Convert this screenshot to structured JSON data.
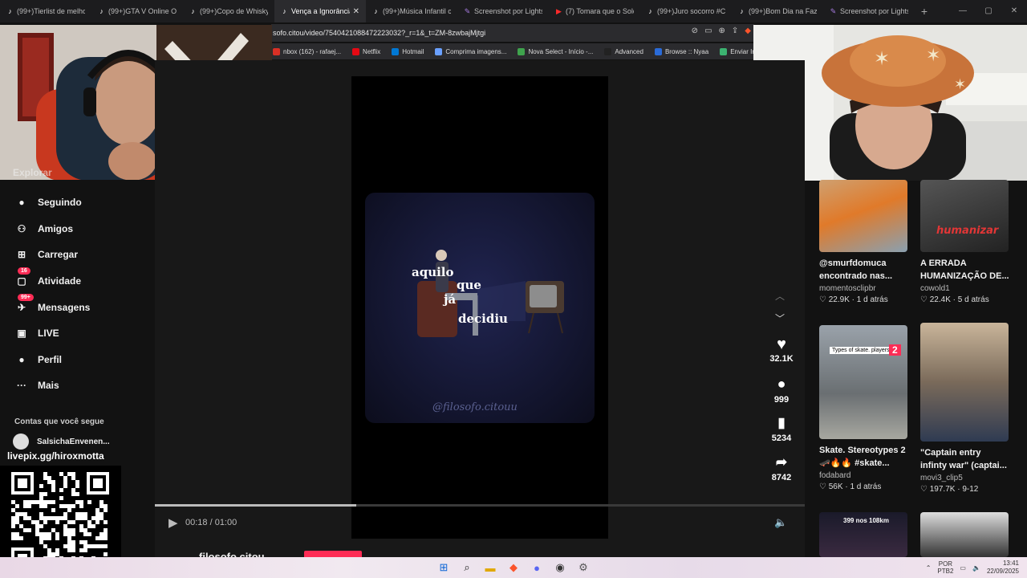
{
  "browser": {
    "tabs": [
      {
        "label": "(99+)Tierlist de melho",
        "icon": "tiktok-icon"
      },
      {
        "label": "(99+)GTA V Online Ou",
        "icon": "tiktok-icon"
      },
      {
        "label": "(99+)Copo de Whisky",
        "icon": "tiktok-icon"
      },
      {
        "label": "Vença a Ignorância",
        "icon": "tiktok-icon",
        "active": true
      },
      {
        "label": "(99+)Música Infantil co",
        "icon": "tiktok-icon"
      },
      {
        "label": "Screenshot por Lightsh",
        "icon": "feather-icon"
      },
      {
        "label": "(7) Tomara que o Sold",
        "icon": "youtube-icon"
      },
      {
        "label": "(99+)Juro socorro #Ca",
        "icon": "tiktok-icon"
      },
      {
        "label": "(99+)Bom Dia na Faze",
        "icon": "tiktok-icon"
      },
      {
        "label": "Screenshot por Lightsh",
        "icon": "feather-icon"
      }
    ],
    "new_tab": "+",
    "url": "sofo.citou/video/7540421088472223032?_r=1&_t=ZM-8zwbajMjtgi",
    "bookmarks": [
      {
        "label": "nbox (162) - rafaej...",
        "color": "#d93025"
      },
      {
        "label": "Netflix",
        "color": "#e50914"
      },
      {
        "label": "Hotmail",
        "color": "#0078d4"
      },
      {
        "label": "Comprima imagens...",
        "color": "#6aa0ff"
      },
      {
        "label": "Nova Select - Início -...",
        "color": "#3fa34d"
      },
      {
        "label": "Advanced",
        "color": "#222222"
      },
      {
        "label": "Browse :: Nyaa",
        "color": "#2a6bd8"
      },
      {
        "label": "Enviar Imagem",
        "color": "#3cb371"
      }
    ]
  },
  "sidebar": {
    "hidden_item": "Explorar",
    "items": [
      {
        "label": "Seguindo",
        "icon": "following-avatar-icon"
      },
      {
        "label": "Amigos",
        "icon": "friends-icon"
      },
      {
        "label": "Carregar",
        "icon": "upload-icon"
      },
      {
        "label": "Atividade",
        "icon": "activity-icon",
        "badge": "16"
      },
      {
        "label": "Mensagens",
        "icon": "messages-icon",
        "badge": "99+"
      },
      {
        "label": "LIVE",
        "icon": "live-icon"
      },
      {
        "label": "Perfil",
        "icon": "profile-avatar-icon"
      },
      {
        "label": "Mais",
        "icon": "more-icon"
      }
    ],
    "section_title": "Contas que você segue",
    "followed_account": "SalsichaEnvenen..."
  },
  "overlay": {
    "livepix": "livepix.gg/hiroxmotta"
  },
  "video": {
    "caption_words": [
      "aquilo",
      "que",
      "já",
      "decidiu"
    ],
    "watermark": "@filosofo.citouu",
    "time": "00:18 / 01:00",
    "progress": 0.31,
    "author": "filosofo.citou"
  },
  "actions": {
    "likes": "32.1K",
    "comments": "999",
    "saves": "5234",
    "shares": "8742"
  },
  "recommendations": [
    {
      "title_line1": "@smurfdomuca",
      "title_line2": "encontrado nas...",
      "user": "momentosclipbr",
      "likes": "22.9K",
      "age": "1 d atrás",
      "thumb_text": ""
    },
    {
      "title_line1": "A ERRADA",
      "title_line2": "HUMANIZAÇÃO DE...",
      "user": "cowold1",
      "likes": "22.4K",
      "age": "5 d atrás",
      "thumb_text": "humanizar"
    },
    {
      "title_line1": "Skate. Stereotypes 2",
      "title_line2": "🛹🔥🔥 #skate...",
      "user": "fodabard",
      "likes": "56K",
      "age": "1 d atrás",
      "thumb_text": "Types of skate. players"
    },
    {
      "title_line1": "\"Captain entry",
      "title_line2": "infinty war\" (captai...",
      "user": "movi3_clip5",
      "likes": "197.7K",
      "age": "9-12",
      "thumb_text": ""
    },
    {
      "thumb_text": "399 nos 108km"
    }
  ],
  "taskbar": {
    "lang_line1": "POR",
    "lang_line2": "PTB2",
    "clock_time": "13:41",
    "clock_date": "22/09/2025"
  },
  "colors": {
    "accent": "#fe2c55",
    "background": "#121212"
  }
}
